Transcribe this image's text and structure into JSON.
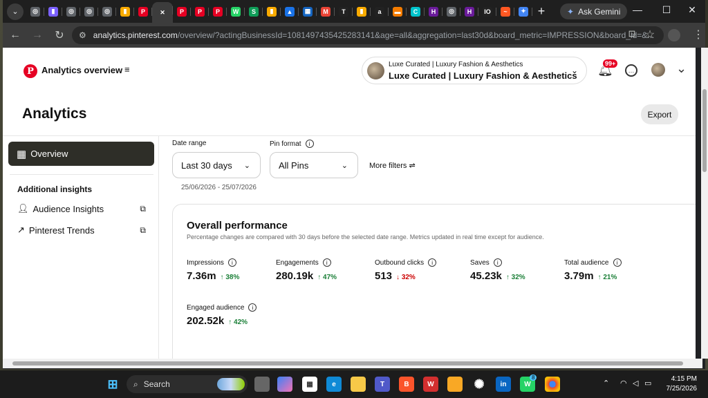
{
  "browser": {
    "tabs": [
      {
        "icon": "globe-icon",
        "color": "#5f6368",
        "glyph": "◎"
      },
      {
        "icon": "analytics-icon",
        "color": "#7b61ff",
        "glyph": "▮"
      },
      {
        "icon": "globe-icon",
        "color": "#5f6368",
        "glyph": "◎"
      },
      {
        "icon": "globe-icon",
        "color": "#5f6368",
        "glyph": "◎"
      },
      {
        "icon": "globe-icon",
        "color": "#5f6368",
        "glyph": "◎"
      },
      {
        "icon": "analytics-icon",
        "color": "#f9ab00",
        "glyph": "▮"
      },
      {
        "icon": "pinterest-icon",
        "color": "#e60023",
        "glyph": "P"
      },
      {
        "icon": "close-icon",
        "color": "#3c3c3c",
        "glyph": "✕",
        "active": true
      },
      {
        "icon": "pinterest-icon",
        "color": "#e60023",
        "glyph": "P"
      },
      {
        "icon": "pinterest-icon",
        "color": "#e60023",
        "glyph": "P"
      },
      {
        "icon": "pinterest-icon",
        "color": "#e60023",
        "glyph": "P"
      },
      {
        "icon": "whatsapp-icon",
        "color": "#25d366",
        "glyph": "W"
      },
      {
        "icon": "sheets-icon",
        "color": "#0f9d58",
        "glyph": "S"
      },
      {
        "icon": "analytics-icon",
        "color": "#f9ab00",
        "glyph": "▮"
      },
      {
        "icon": "drive-icon",
        "color": "#1a73e8",
        "glyph": "▲"
      },
      {
        "icon": "bank-icon",
        "color": "#1565c0",
        "glyph": "▦"
      },
      {
        "icon": "gmail-icon",
        "color": "#ea4335",
        "glyph": "M"
      },
      {
        "icon": "threads-icon",
        "color": "#222",
        "glyph": "T"
      },
      {
        "icon": "analytics-icon",
        "color": "#f9ab00",
        "glyph": "▮"
      },
      {
        "icon": "amazon-icon",
        "color": "#222",
        "glyph": "a"
      },
      {
        "icon": "generic-icon",
        "color": "#f57c00",
        "glyph": "▬"
      },
      {
        "icon": "canva-icon",
        "color": "#00c4cc",
        "glyph": "C"
      },
      {
        "icon": "app-icon",
        "color": "#6a1b9a",
        "glyph": "H"
      },
      {
        "icon": "chrome-icon",
        "color": "#5f6368",
        "glyph": "◎"
      },
      {
        "icon": "app-icon",
        "color": "#6a1b9a",
        "glyph": "H"
      },
      {
        "icon": "io-icon",
        "color": "#222",
        "glyph": "IO"
      },
      {
        "icon": "generic-icon",
        "color": "#ff5722",
        "glyph": "~"
      },
      {
        "icon": "gemini-icon",
        "color": "#4285f4",
        "glyph": "✦"
      }
    ],
    "ask_gemini": "Ask Gemini",
    "url_host": "analytics.pinterest.com",
    "url_rest": "/overview/?actingBusinessId=1081497435425283141&age=all&aggregation=last30d&board_metric=IMPRESSION&board_id=&..."
  },
  "header": {
    "title": "Analytics overview",
    "account_small": "Luxe Curated | Luxury Fashion & Aesthetics",
    "account_name": "Luxe Curated | Luxury Fashion & Aesthetics",
    "notif_badge": "99+"
  },
  "page": {
    "heading": "Analytics",
    "export_label": "Export"
  },
  "sidebar": {
    "overview": "Overview",
    "section": "Additional insights",
    "items": [
      {
        "label": "Audience Insights"
      },
      {
        "label": "Pinterest Trends"
      }
    ]
  },
  "filters": {
    "date_label": "Date range",
    "date_value": "Last 30 days",
    "format_label": "Pin format",
    "format_value": "All Pins",
    "more": "More filters",
    "date_span": "25/06/2026 - 25/07/2026"
  },
  "performance": {
    "title": "Overall performance",
    "subtitle": "Percentage changes are compared with 30 days before the selected date range. Metrics updated in real time except for audience.",
    "metrics": [
      {
        "name": "Impressions",
        "value": "7.36m",
        "change": "38%",
        "dir": "up"
      },
      {
        "name": "Engagements",
        "value": "280.19k",
        "change": "47%",
        "dir": "up"
      },
      {
        "name": "Outbound clicks",
        "value": "513",
        "change": "32%",
        "dir": "down"
      },
      {
        "name": "Saves",
        "value": "45.23k",
        "change": "32%",
        "dir": "up"
      },
      {
        "name": "Total audience",
        "value": "3.79m",
        "change": "21%",
        "dir": "up"
      },
      {
        "name": "Engaged audience",
        "value": "202.52k",
        "change": "42%",
        "dir": "up"
      }
    ]
  },
  "taskbar": {
    "search": "Search",
    "time": "4:15 PM",
    "date": "7/25/2026",
    "whatsapp_badge": "8"
  }
}
